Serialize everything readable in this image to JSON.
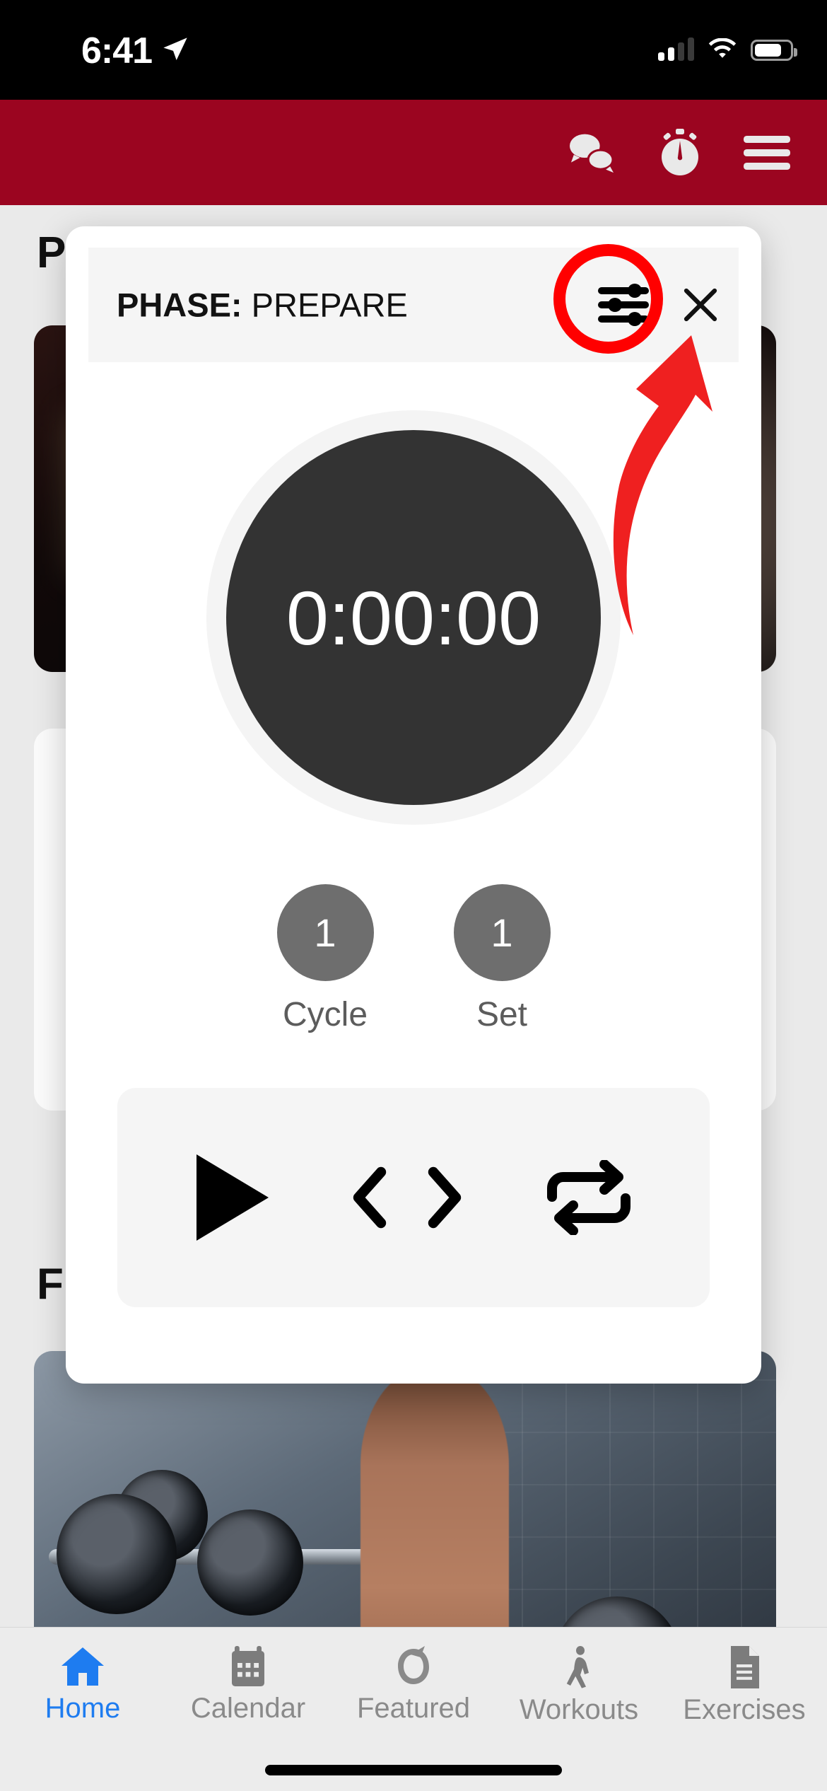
{
  "status_bar": {
    "time": "6:41",
    "location_icon": "location-arrow-icon",
    "cellular_icon": "cellular-signal-icon",
    "cellular_bars_filled": 2,
    "wifi_icon": "wifi-icon",
    "battery_icon": "battery-icon",
    "battery_level_pct": 68
  },
  "app_bar": {
    "background_color": "#9b0520",
    "actions": [
      {
        "name": "chat-icon",
        "label": "Chat"
      },
      {
        "name": "timer-icon",
        "label": "Timer"
      },
      {
        "name": "menu-icon",
        "label": "Menu"
      }
    ]
  },
  "background_page": {
    "heading_1": "P",
    "heading_2": "F"
  },
  "timer_modal": {
    "header": {
      "phase_label": "PHASE:",
      "phase_value": "PREPARE",
      "settings_icon": "sliders-settings-icon",
      "close_icon": "close-x-icon"
    },
    "timer": {
      "display": "0:00:00",
      "disc_color": "#333333",
      "ring_color": "#f4f4f4",
      "text_color": "#ffffff"
    },
    "counters": [
      {
        "name": "cycle",
        "value": "1",
        "label": "Cycle"
      },
      {
        "name": "set",
        "value": "1",
        "label": "Set"
      }
    ],
    "controls": [
      {
        "name": "play-button",
        "icon": "play-icon",
        "label": "Play"
      },
      {
        "name": "previous-button",
        "icon": "chevron-left-icon",
        "label": "Previous"
      },
      {
        "name": "next-button",
        "icon": "chevron-right-icon",
        "label": "Next"
      },
      {
        "name": "repeat-button",
        "icon": "repeat-loop-icon",
        "label": "Repeat"
      }
    ]
  },
  "annotations": {
    "highlight_color": "#ff0000",
    "circle_target": "sliders-settings-icon",
    "arrow": "curved-arrow-pointing-to-settings-icon"
  },
  "tab_bar": {
    "active": "Home",
    "active_color": "#1e7cf0",
    "inactive_color": "#8a8a8a",
    "items": [
      {
        "label": "Home",
        "icon": "home-icon"
      },
      {
        "label": "Calendar",
        "icon": "calendar-icon"
      },
      {
        "label": "Featured",
        "icon": "featured-icon"
      },
      {
        "label": "Workouts",
        "icon": "walking-person-icon"
      },
      {
        "label": "Exercises",
        "icon": "document-icon"
      }
    ]
  }
}
